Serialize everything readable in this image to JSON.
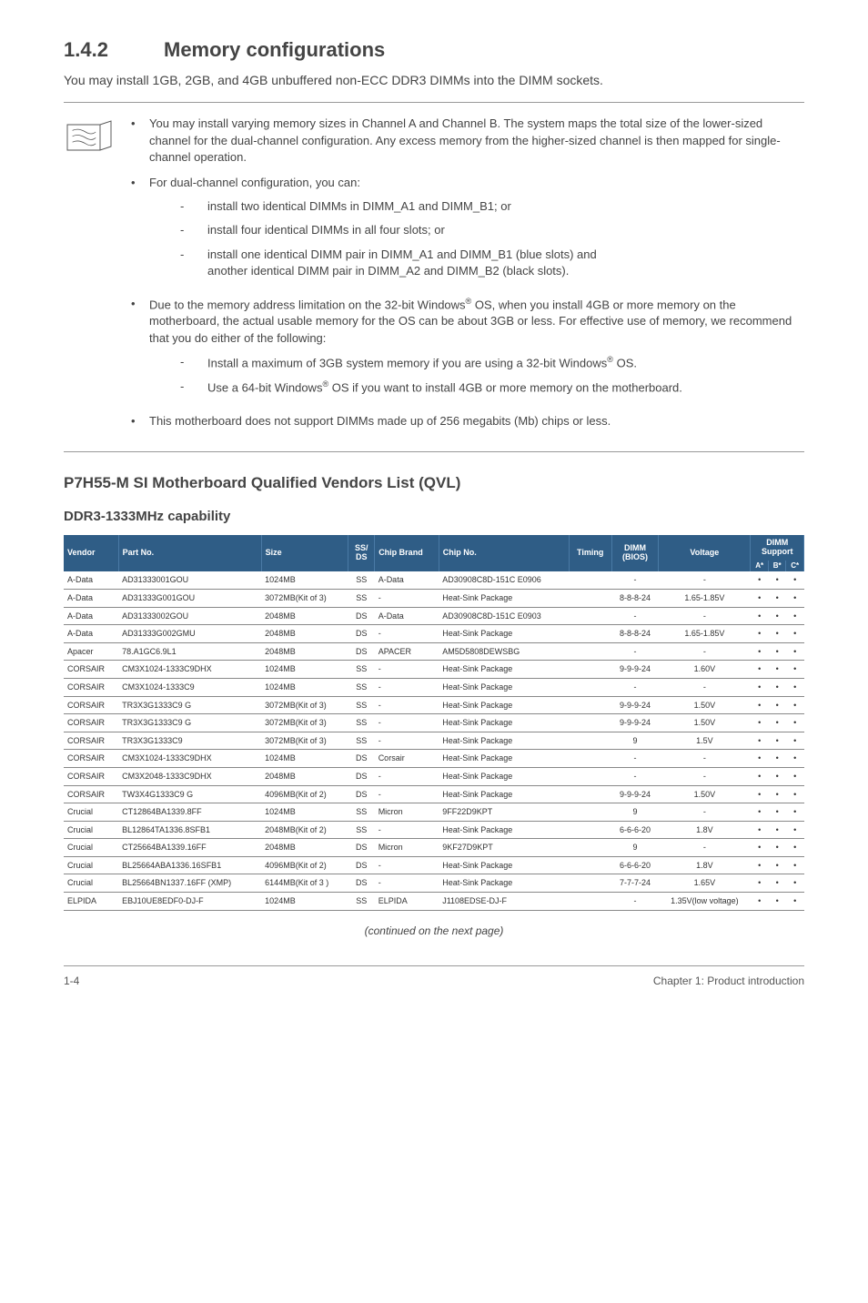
{
  "section": {
    "number": "1.4.2",
    "title": "Memory configurations"
  },
  "intro": "You may install 1GB, 2GB, and 4GB unbuffered non-ECC DDR3 DIMMs into the DIMM sockets.",
  "notes": {
    "b1": "You may install varying memory sizes in Channel A and Channel B. The system maps the total size of the lower-sized channel for the dual-channel configuration. Any excess memory from the higher-sized channel is then mapped for single-channel operation.",
    "b2": "For dual-channel configuration, you can:",
    "b2s1": "install two identical DIMMs in DIMM_A1 and DIMM_B1; or",
    "b2s2": "install four identical DIMMs in all four slots; or",
    "b2s3a": "install one identical DIMM pair in DIMM_A1 and DIMM_B1 (blue slots) and",
    "b2s3b": " another identical DIMM pair in DIMM_A2 and DIMM_B2 (black slots).",
    "b3a": "Due to the memory address limitation on the 32-bit Windows",
    "b3b": " OS, when you install 4GB or more memory on the motherboard, the actual usable memory for the OS can be about 3GB or less. For effective use of memory, we recommend that you do either of the following:",
    "b3s1a": "Install a maximum of 3GB system memory if you are using a 32-bit Windows",
    "b3s1b": " OS.",
    "b3s2a": "Use a 64-bit Windows",
    "b3s2b": " OS if you want to install 4GB or more memory on the motherboard.",
    "b4": "This motherboard does not support DIMMs made up of 256 megabits (Mb) chips or less."
  },
  "qvl_title": "P7H55-M SI Motherboard Qualified Vendors List (QVL)",
  "capability_title": "DDR3-1333MHz capability",
  "headers": {
    "vendor": "Vendor",
    "part": "Part No.",
    "size": "Size",
    "ssds": "SS/\nDS",
    "brand": "Chip Brand",
    "chipno": "Chip No.",
    "timing": "Timing",
    "dimm": "DIMM\n(BIOS)",
    "voltage": "Voltage",
    "support": "DIMM\nSupport",
    "a": "A*",
    "b": "B*",
    "c": "C*"
  },
  "rows": [
    {
      "vendor": "A-Data",
      "part": "AD31333001GOU",
      "size": "1024MB",
      "ssds": "SS",
      "brand": "A-Data",
      "chipno": "AD30908C8D-151C E0906",
      "timing": "",
      "dimm": "-",
      "voltage": "-",
      "a": "•",
      "b": "•",
      "c": "•"
    },
    {
      "vendor": "A-Data",
      "part": "AD31333G001GOU",
      "size": "3072MB(Kit of 3)",
      "ssds": "SS",
      "brand": "-",
      "chipno": "Heat-Sink Package",
      "timing": "",
      "dimm": "8-8-8-24",
      "voltage": "1.65-1.85V",
      "a": "•",
      "b": "•",
      "c": "•"
    },
    {
      "vendor": "A-Data",
      "part": "AD31333002GOU",
      "size": "2048MB",
      "ssds": "DS",
      "brand": "A-Data",
      "chipno": "AD30908C8D-151C E0903",
      "timing": "",
      "dimm": "-",
      "voltage": "-",
      "a": "•",
      "b": "•",
      "c": "•"
    },
    {
      "vendor": "A-Data",
      "part": "AD31333G002GMU",
      "size": "2048MB",
      "ssds": "DS",
      "brand": "-",
      "chipno": "Heat-Sink Package",
      "timing": "",
      "dimm": "8-8-8-24",
      "voltage": "1.65-1.85V",
      "a": "•",
      "b": "•",
      "c": "•"
    },
    {
      "vendor": "Apacer",
      "part": "78.A1GC6.9L1",
      "size": "2048MB",
      "ssds": "DS",
      "brand": "APACER",
      "chipno": "AM5D5808DEWSBG",
      "timing": "",
      "dimm": "-",
      "voltage": "-",
      "a": "•",
      "b": "•",
      "c": "•"
    },
    {
      "vendor": "CORSAIR",
      "part": "CM3X1024-1333C9DHX",
      "size": "1024MB",
      "ssds": "SS",
      "brand": "-",
      "chipno": "Heat-Sink Package",
      "timing": "",
      "dimm": "9-9-9-24",
      "voltage": "1.60V",
      "a": "•",
      "b": "•",
      "c": "•"
    },
    {
      "vendor": "CORSAIR",
      "part": "CM3X1024-1333C9",
      "size": "1024MB",
      "ssds": "SS",
      "brand": "-",
      "chipno": "Heat-Sink Package",
      "timing": "",
      "dimm": "-",
      "voltage": "-",
      "a": "•",
      "b": "•",
      "c": "•"
    },
    {
      "vendor": "CORSAIR",
      "part": "TR3X3G1333C9 G",
      "size": "3072MB(Kit of 3)",
      "ssds": "SS",
      "brand": "-",
      "chipno": "Heat-Sink Package",
      "timing": "",
      "dimm": "9-9-9-24",
      "voltage": "1.50V",
      "a": "•",
      "b": "•",
      "c": "•"
    },
    {
      "vendor": "CORSAIR",
      "part": "TR3X3G1333C9 G",
      "size": "3072MB(Kit of 3)",
      "ssds": "SS",
      "brand": "-",
      "chipno": "Heat-Sink Package",
      "timing": "",
      "dimm": "9-9-9-24",
      "voltage": "1.50V",
      "a": "•",
      "b": "•",
      "c": "•"
    },
    {
      "vendor": "CORSAIR",
      "part": "TR3X3G1333C9",
      "size": "3072MB(Kit of 3)",
      "ssds": "SS",
      "brand": "-",
      "chipno": "Heat-Sink Package",
      "timing": "",
      "dimm": "9",
      "voltage": "1.5V",
      "a": "•",
      "b": "•",
      "c": "•"
    },
    {
      "vendor": "CORSAIR",
      "part": "CM3X1024-1333C9DHX",
      "size": "1024MB",
      "ssds": "DS",
      "brand": "Corsair",
      "chipno": "Heat-Sink Package",
      "timing": "",
      "dimm": "-",
      "voltage": "-",
      "a": "•",
      "b": "•",
      "c": "•"
    },
    {
      "vendor": "CORSAIR",
      "part": "CM3X2048-1333C9DHX",
      "size": "2048MB",
      "ssds": "DS",
      "brand": "-",
      "chipno": "Heat-Sink Package",
      "timing": "",
      "dimm": "-",
      "voltage": "-",
      "a": "•",
      "b": "•",
      "c": "•"
    },
    {
      "vendor": "CORSAIR",
      "part": "TW3X4G1333C9 G",
      "size": "4096MB(Kit of 2)",
      "ssds": "DS",
      "brand": "-",
      "chipno": "Heat-Sink Package",
      "timing": "",
      "dimm": "9-9-9-24",
      "voltage": "1.50V",
      "a": "•",
      "b": "•",
      "c": "•"
    },
    {
      "vendor": "Crucial",
      "part": "CT12864BA1339.8FF",
      "size": "1024MB",
      "ssds": "SS",
      "brand": "Micron",
      "chipno": "9FF22D9KPT",
      "timing": "",
      "dimm": "9",
      "voltage": "-",
      "a": "•",
      "b": "•",
      "c": "•"
    },
    {
      "vendor": "Crucial",
      "part": "BL12864TA1336.8SFB1",
      "size": "2048MB(Kit of 2)",
      "ssds": "SS",
      "brand": "-",
      "chipno": "Heat-Sink Package",
      "timing": "",
      "dimm": "6-6-6-20",
      "voltage": "1.8V",
      "a": "•",
      "b": "•",
      "c": "•"
    },
    {
      "vendor": "Crucial",
      "part": "CT25664BA1339.16FF",
      "size": "2048MB",
      "ssds": "DS",
      "brand": "Micron",
      "chipno": "9KF27D9KPT",
      "timing": "",
      "dimm": "9",
      "voltage": "-",
      "a": "•",
      "b": "•",
      "c": "•"
    },
    {
      "vendor": "Crucial",
      "part": "BL25664ABA1336.16SFB1",
      "size": "4096MB(Kit of 2)",
      "ssds": "DS",
      "brand": "-",
      "chipno": "Heat-Sink Package",
      "timing": "",
      "dimm": "6-6-6-20",
      "voltage": "1.8V",
      "a": "•",
      "b": "•",
      "c": "•"
    },
    {
      "vendor": "Crucial",
      "part": "BL25664BN1337.16FF (XMP)",
      "size": "6144MB(Kit of 3 )",
      "ssds": "DS",
      "brand": "-",
      "chipno": "Heat-Sink Package",
      "timing": "",
      "dimm": "7-7-7-24",
      "voltage": "1.65V",
      "a": "•",
      "b": "•",
      "c": "•"
    },
    {
      "vendor": "ELPIDA",
      "part": "EBJ10UE8EDF0-DJ-F",
      "size": "1024MB",
      "ssds": "SS",
      "brand": "ELPIDA",
      "chipno": "J1108EDSE-DJ-F",
      "timing": "",
      "dimm": "-",
      "voltage": "1.35V(low voltage)",
      "a": "•",
      "b": "•",
      "c": "•"
    }
  ],
  "continued": "(continued on the next page)",
  "footer": {
    "left": "1-4",
    "right": "Chapter 1: Product introduction"
  }
}
